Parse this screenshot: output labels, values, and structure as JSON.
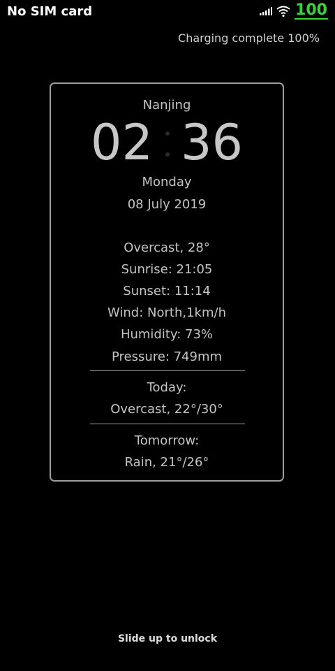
{
  "status_bar": {
    "carrier": "No SIM card",
    "battery_level": "100",
    "battery_color": "#39d33d",
    "icons": [
      "signal-icon",
      "wifi-icon",
      "battery-icon"
    ]
  },
  "charging_status": "Charging complete 100%",
  "weather_widget": {
    "city": "Nanjing",
    "hours": "02",
    "minutes": "36",
    "weekday": "Monday",
    "date": "08 July 2019",
    "condition": "Overcast, 28°",
    "sunrise": "Sunrise: 21:05",
    "sunset": "Sunset: 11:14",
    "wind": "Wind: North,1km/h",
    "humidity": "Humidity: 73%",
    "pressure": "Pressure: 749mm",
    "today_label": "Today:",
    "today_forecast": "Overcast, 22°/30°",
    "tomorrow_label": "Tomorrow:",
    "tomorrow_forecast": "Rain, 21°/26°"
  },
  "unlock_hint": "Slide up to unlock"
}
